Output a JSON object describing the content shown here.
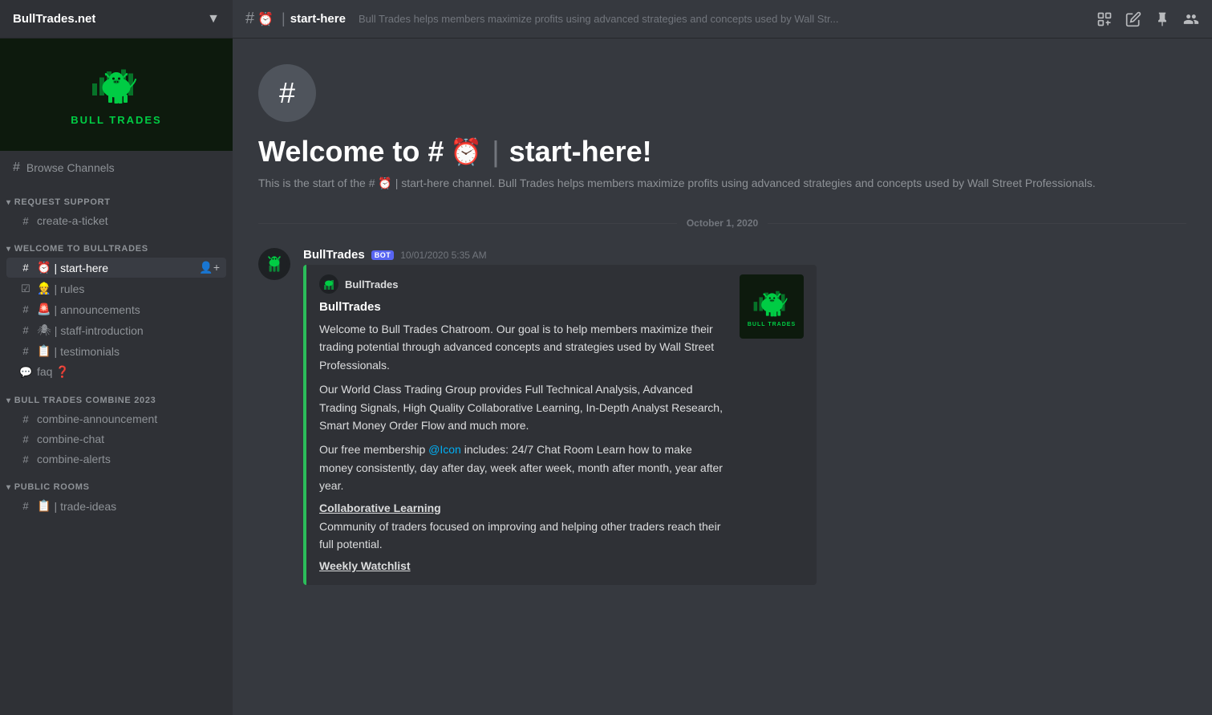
{
  "server": {
    "name": "BullTrades.net",
    "dropdown_icon": "▼"
  },
  "sidebar": {
    "browse_channels_label": "Browse Channels",
    "categories": [
      {
        "id": "request-support",
        "label": "REQUEST SUPPORT",
        "channels": [
          {
            "id": "create-a-ticket",
            "name": "create-a-ticket",
            "emoji": "",
            "hash": true
          }
        ]
      },
      {
        "id": "welcome-to-bulltrades",
        "label": "WELCOME TO BULLTRADES",
        "channels": [
          {
            "id": "start-here",
            "name": "start-here",
            "emoji": "⏰",
            "hash": true,
            "active": true,
            "add_member": true
          },
          {
            "id": "rules",
            "name": "rules",
            "emoji": "👷",
            "hash": false,
            "checkbox": true
          },
          {
            "id": "announcements",
            "name": "announcements",
            "emoji": "🚨",
            "hash": true
          },
          {
            "id": "staff-introduction",
            "name": "staff-introduction",
            "emoji": "🕷",
            "hash": true
          },
          {
            "id": "testimonials",
            "name": "testimonials",
            "emoji": "📋",
            "hash": true
          },
          {
            "id": "faq",
            "name": "faq ❓",
            "emoji": "",
            "hash": false,
            "question": true
          }
        ]
      },
      {
        "id": "bull-trades-combine-2023",
        "label": "BULL TRADES COMBINE 2023",
        "channels": [
          {
            "id": "combine-announcement",
            "name": "combine-announcement",
            "emoji": "",
            "hash": true
          },
          {
            "id": "combine-chat",
            "name": "combine-chat",
            "emoji": "",
            "hash": true
          },
          {
            "id": "combine-alerts",
            "name": "combine-alerts",
            "emoji": "",
            "hash": true
          }
        ]
      },
      {
        "id": "public-rooms",
        "label": "PUBLIC ROOMS",
        "channels": [
          {
            "id": "trade-ideas",
            "name": "trade-ideas",
            "emoji": "📋",
            "hash": true
          }
        ]
      }
    ]
  },
  "topbar": {
    "channel_name": "start-here",
    "channel_emoji": "⏰",
    "description": "Bull Trades helps members maximize profits using advanced strategies and concepts used by Wall Str..."
  },
  "channel_header": {
    "welcome_prefix": "Welcome to #",
    "welcome_emoji": "⏰",
    "welcome_pipe": "|",
    "welcome_suffix": "start-here!",
    "description": "This is the start of the # ⏰ | start-here channel. Bull Trades helps members maximize profits using advanced strategies and concepts used by Wall Street Professionals."
  },
  "date_divider": {
    "label": "October 1, 2020"
  },
  "message": {
    "username": "BullTrades",
    "bot_badge": "BOT",
    "timestamp": "10/01/2020 5:35 AM",
    "embed": {
      "author": "BullTrades",
      "title": "BullTrades",
      "description_1": "Welcome to Bull Trades Chatroom. Our goal is to help members maximize their trading potential through advanced concepts and strategies used by Wall Street Professionals.",
      "description_2": "Our World Class Trading Group provides Full Technical Analysis, Advanced Trading Signals, High Quality Collaborative Learning, In-Depth Analyst Research, Smart Money Order Flow and much more.",
      "description_3_prefix": "Our free membership ",
      "description_3_link": "@Icon",
      "description_3_suffix": " includes: 24/7 Chat Room Learn how to make money consistently, day after day, week after week, month after month, year after year.",
      "section_1_title": "Collaborative Learning",
      "section_1_text": "Community of traders focused on improving and helping other traders reach their full potential.",
      "section_2_title": "Weekly Watchlist"
    }
  }
}
